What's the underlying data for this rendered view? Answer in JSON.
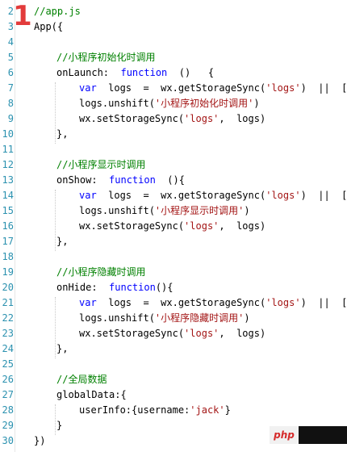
{
  "editor": {
    "step_marker": "1",
    "lines": [
      {
        "n": "2",
        "indent": 0,
        "tokens": [
          {
            "t": "//app.js",
            "c": "comment"
          }
        ]
      },
      {
        "n": "3",
        "indent": 0,
        "tokens": [
          {
            "t": "App({",
            "c": "plain"
          }
        ]
      },
      {
        "n": "4",
        "indent": 0,
        "tokens": []
      },
      {
        "n": "5",
        "indent": 1,
        "tokens": [
          {
            "t": "//小程序初始化时调用",
            "c": "comment"
          }
        ]
      },
      {
        "n": "6",
        "indent": 1,
        "tokens": [
          {
            "t": "onLaunch:  ",
            "c": "plain"
          },
          {
            "t": "function",
            "c": "keyword"
          },
          {
            "t": "  ()   {",
            "c": "plain"
          }
        ]
      },
      {
        "n": "7",
        "indent": 2,
        "tokens": [
          {
            "t": "var",
            "c": "keyword"
          },
          {
            "t": "  logs  =  wx.getStorageSync(",
            "c": "plain"
          },
          {
            "t": "'logs'",
            "c": "string"
          },
          {
            "t": ")  ||  []",
            "c": "plain"
          }
        ]
      },
      {
        "n": "8",
        "indent": 2,
        "tokens": [
          {
            "t": "logs.unshift(",
            "c": "plain"
          },
          {
            "t": "'小程序初始化时调用'",
            "c": "string"
          },
          {
            "t": ")",
            "c": "plain"
          }
        ]
      },
      {
        "n": "9",
        "indent": 2,
        "tokens": [
          {
            "t": "wx.setStorageSync(",
            "c": "plain"
          },
          {
            "t": "'logs'",
            "c": "string"
          },
          {
            "t": ",  logs)",
            "c": "plain"
          }
        ]
      },
      {
        "n": "10",
        "indent": 1,
        "tokens": [
          {
            "t": "},",
            "c": "plain"
          }
        ]
      },
      {
        "n": "11",
        "indent": 0,
        "tokens": []
      },
      {
        "n": "12",
        "indent": 1,
        "tokens": [
          {
            "t": "//小程序显示时调用",
            "c": "comment"
          }
        ]
      },
      {
        "n": "13",
        "indent": 1,
        "tokens": [
          {
            "t": "onShow:  ",
            "c": "plain"
          },
          {
            "t": "function",
            "c": "keyword"
          },
          {
            "t": "  (){",
            "c": "plain"
          }
        ]
      },
      {
        "n": "14",
        "indent": 2,
        "tokens": [
          {
            "t": "var",
            "c": "keyword"
          },
          {
            "t": "  logs  =  wx.getStorageSync(",
            "c": "plain"
          },
          {
            "t": "'logs'",
            "c": "string"
          },
          {
            "t": ")  ||  []",
            "c": "plain"
          }
        ]
      },
      {
        "n": "15",
        "indent": 2,
        "tokens": [
          {
            "t": "logs.unshift(",
            "c": "plain"
          },
          {
            "t": "'小程序显示时调用'",
            "c": "string"
          },
          {
            "t": ")",
            "c": "plain"
          }
        ]
      },
      {
        "n": "16",
        "indent": 2,
        "tokens": [
          {
            "t": "wx.setStorageSync(",
            "c": "plain"
          },
          {
            "t": "'logs'",
            "c": "string"
          },
          {
            "t": ",  logs)",
            "c": "plain"
          }
        ]
      },
      {
        "n": "17",
        "indent": 1,
        "tokens": [
          {
            "t": "},",
            "c": "plain"
          }
        ]
      },
      {
        "n": "18",
        "indent": 0,
        "tokens": []
      },
      {
        "n": "19",
        "indent": 1,
        "tokens": [
          {
            "t": "//小程序隐藏时调用",
            "c": "comment"
          }
        ]
      },
      {
        "n": "20",
        "indent": 1,
        "tokens": [
          {
            "t": "onHide:  ",
            "c": "plain"
          },
          {
            "t": "function",
            "c": "keyword"
          },
          {
            "t": "(){",
            "c": "plain"
          }
        ]
      },
      {
        "n": "21",
        "indent": 2,
        "tokens": [
          {
            "t": "var",
            "c": "keyword"
          },
          {
            "t": "  logs  =  wx.getStorageSync(",
            "c": "plain"
          },
          {
            "t": "'logs'",
            "c": "string"
          },
          {
            "t": ")  ||  []",
            "c": "plain"
          }
        ]
      },
      {
        "n": "22",
        "indent": 2,
        "tokens": [
          {
            "t": "logs.unshift(",
            "c": "plain"
          },
          {
            "t": "'小程序隐藏时调用'",
            "c": "string"
          },
          {
            "t": ")",
            "c": "plain"
          }
        ]
      },
      {
        "n": "23",
        "indent": 2,
        "tokens": [
          {
            "t": "wx.setStorageSync(",
            "c": "plain"
          },
          {
            "t": "'logs'",
            "c": "string"
          },
          {
            "t": ",  logs)",
            "c": "plain"
          }
        ]
      },
      {
        "n": "24",
        "indent": 1,
        "tokens": [
          {
            "t": "},",
            "c": "plain"
          }
        ]
      },
      {
        "n": "25",
        "indent": 0,
        "tokens": []
      },
      {
        "n": "26",
        "indent": 1,
        "tokens": [
          {
            "t": "//全局数据",
            "c": "comment"
          }
        ]
      },
      {
        "n": "27",
        "indent": 1,
        "tokens": [
          {
            "t": "globalData:{",
            "c": "plain"
          }
        ]
      },
      {
        "n": "28",
        "indent": 2,
        "tokens": [
          {
            "t": "userInfo:{username:",
            "c": "plain"
          },
          {
            "t": "'jack'",
            "c": "string"
          },
          {
            "t": "}",
            "c": "plain"
          }
        ]
      },
      {
        "n": "29",
        "indent": 1,
        "tokens": [
          {
            "t": "}",
            "c": "plain"
          }
        ]
      },
      {
        "n": "30",
        "indent": 0,
        "tokens": [
          {
            "t": "})",
            "c": "plain"
          }
        ]
      }
    ]
  },
  "watermark": {
    "text": "php"
  },
  "colors": {
    "comment": "#008000",
    "keyword": "#0000ff",
    "string": "#a31515",
    "line_number": "#2b91af",
    "step_marker": "#e23b3b"
  }
}
